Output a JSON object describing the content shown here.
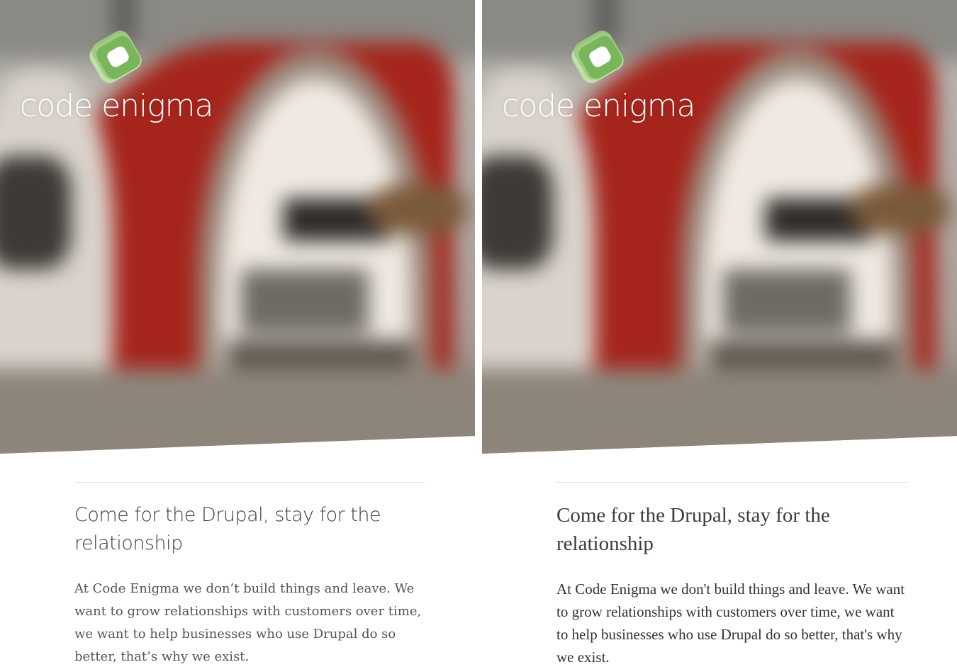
{
  "panels": [
    {
      "logo": {
        "text": "code enigma",
        "icon": "code-enigma-logo-icon"
      },
      "heading": "Come for the Drupal, stay for the relationship",
      "body": "At Code Enigma we don’t build things and leave. We want to grow relationships with customers over time, we want to help businesses who use Drupal do so better, that’s why we exist."
    },
    {
      "logo": {
        "text": "code enigma",
        "icon": "code-enigma-logo-icon"
      },
      "heading": "Come for the Drupal, stay for the relationship",
      "body": "At Code Enigma we don't build things and leave. We want to grow relationships with customers over time, we want to help businesses who use Drupal do so better, that's why we exist."
    }
  ],
  "colors": {
    "logo_green_light": "#a8d08d",
    "logo_green_dark": "#6eaa4f",
    "hero_red": "#a5251c",
    "text_dark": "#3d3d3d",
    "rule": "#e3e3e3"
  }
}
